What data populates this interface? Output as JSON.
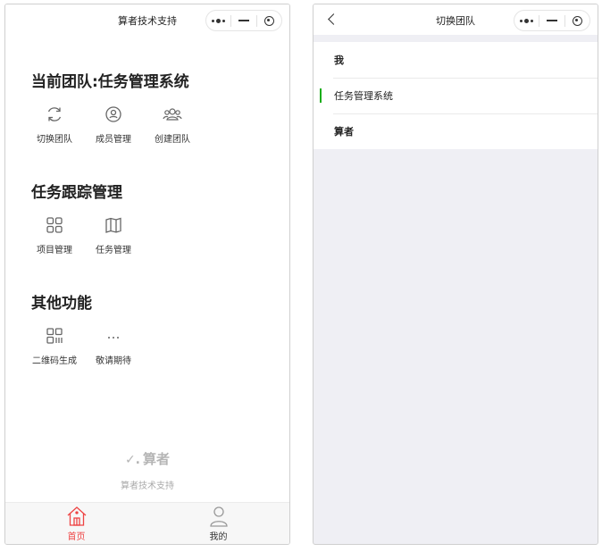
{
  "left": {
    "nav_title": "算者技术支持",
    "sections": [
      {
        "title": "当前团队:任务管理系统",
        "items": [
          {
            "label": "切换团队",
            "icon": "refresh-icon"
          },
          {
            "label": "成员管理",
            "icon": "user-circle-icon"
          },
          {
            "label": "创建团队",
            "icon": "group-icon"
          }
        ]
      },
      {
        "title": "任务跟踪管理",
        "items": [
          {
            "label": "项目管理",
            "icon": "grid-icon"
          },
          {
            "label": "任务管理",
            "icon": "map-icon"
          }
        ]
      },
      {
        "title": "其他功能",
        "items": [
          {
            "label": "二维码生成",
            "icon": "qrcode-icon"
          },
          {
            "label": "敬请期待",
            "icon": "more-icon"
          }
        ]
      }
    ],
    "footer_brand": "算者",
    "footer_sub": "算者技术支持",
    "tabs": [
      {
        "label": "首页",
        "icon": "home-icon",
        "active": true
      },
      {
        "label": "我的",
        "icon": "profile-icon",
        "active": false
      }
    ]
  },
  "right": {
    "nav_title": "切换团队",
    "teams": [
      {
        "name": "我",
        "active": false
      },
      {
        "name": "任务管理系统",
        "active": true
      },
      {
        "name": "算者",
        "active": false
      }
    ]
  },
  "colors": {
    "active_tab": "#ee4444",
    "active_indicator": "#1aad19",
    "page_bg": "#efeff4"
  }
}
